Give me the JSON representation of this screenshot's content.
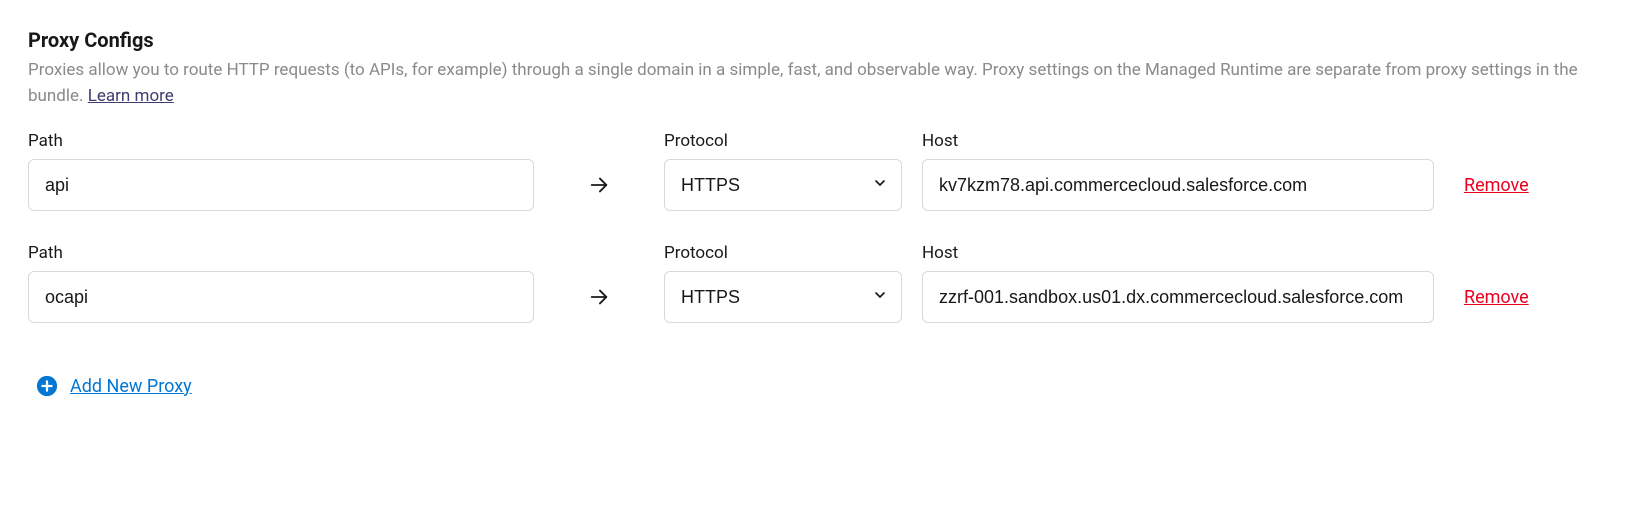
{
  "section": {
    "title": "Proxy Configs",
    "description": "Proxies allow you to route HTTP requests (to APIs, for example) through a single domain in a simple, fast, and observable way. Proxy settings on the Managed Runtime are separate from proxy settings in the bundle. ",
    "learn_more": "Learn more"
  },
  "labels": {
    "path": "Path",
    "protocol": "Protocol",
    "host": "Host",
    "remove": "Remove",
    "add_new_proxy": "Add New Proxy"
  },
  "proxies": [
    {
      "path": "api",
      "protocol": "HTTPS",
      "host": "kv7kzm78.api.commercecloud.salesforce.com"
    },
    {
      "path": "ocapi",
      "protocol": "HTTPS",
      "host": "zzrf-001.sandbox.us01.dx.commercecloud.salesforce.com"
    }
  ]
}
